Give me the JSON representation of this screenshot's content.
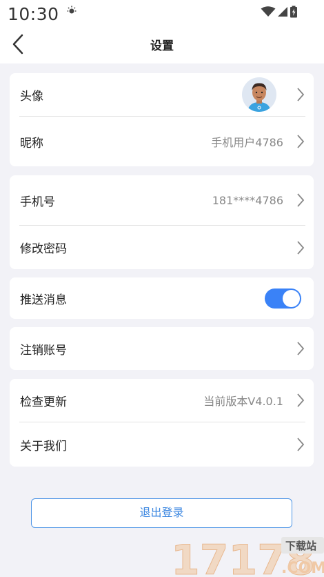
{
  "status_bar": {
    "time": "10:30"
  },
  "header": {
    "title": "设置"
  },
  "profile_card": {
    "avatar_label": "头像",
    "nickname_label": "昵称",
    "nickname_value": "手机用户4786"
  },
  "account_card": {
    "phone_label": "手机号",
    "phone_value": "181****4786",
    "password_label": "修改密码"
  },
  "push_card": {
    "label": "推送消息",
    "enabled": true
  },
  "cancel_card": {
    "label": "注销账号"
  },
  "about_card": {
    "update_label": "检查更新",
    "version_value": "当前版本V4.0.1",
    "about_label": "关于我们"
  },
  "logout_label": "退出登录",
  "watermark": {
    "number": "17178",
    "tag": "下载站",
    "domain": ".COM"
  },
  "colors": {
    "accent": "#3a82f7",
    "background": "#f2f2f7",
    "secondary_text": "#888888"
  }
}
